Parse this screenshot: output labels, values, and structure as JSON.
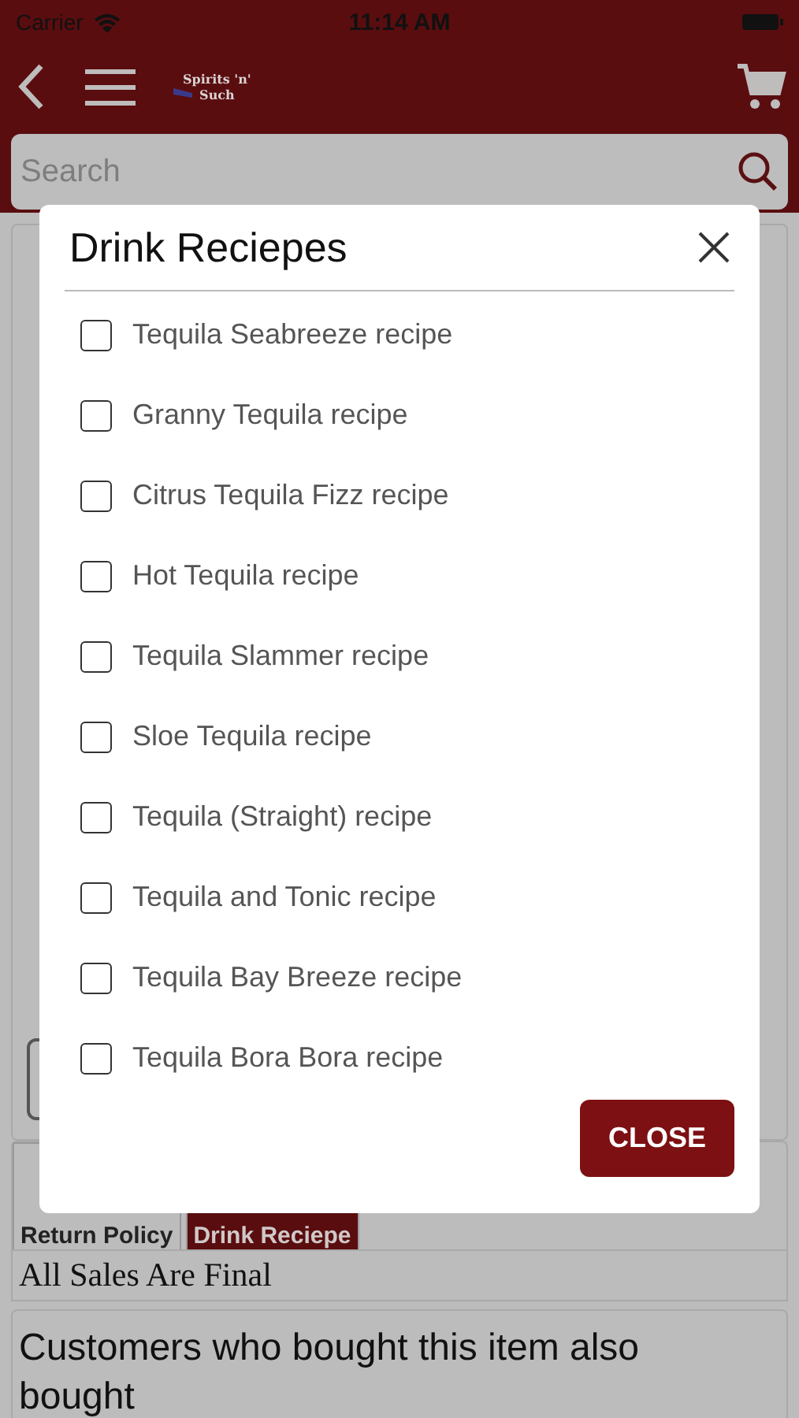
{
  "status_bar": {
    "carrier": "Carrier",
    "time": "11:14 AM"
  },
  "nav": {
    "logo_lines": [
      "Spirits 'n'",
      "Such"
    ]
  },
  "search": {
    "placeholder": "Search"
  },
  "tabs": [
    {
      "label": "Return Policy",
      "selected": false
    },
    {
      "label": "Drink Reciepe",
      "selected": true
    }
  ],
  "tab_content": "All Sales Are Final",
  "related": {
    "title": "Customers who bought this item also bought"
  },
  "dialog": {
    "title": "Drink Reciepes",
    "items": [
      {
        "label": "Tequila Seabreeze recipe",
        "checked": false
      },
      {
        "label": "Granny Tequila recipe",
        "checked": false
      },
      {
        "label": "Citrus Tequila Fizz recipe",
        "checked": false
      },
      {
        "label": "Hot Tequila recipe",
        "checked": false
      },
      {
        "label": "Tequila Slammer recipe",
        "checked": false
      },
      {
        "label": "Sloe Tequila recipe",
        "checked": false
      },
      {
        "label": "Tequila (Straight) recipe",
        "checked": false
      },
      {
        "label": "Tequila and Tonic recipe",
        "checked": false
      },
      {
        "label": "Tequila Bay Breeze recipe",
        "checked": false
      },
      {
        "label": "Tequila Bora Bora recipe",
        "checked": false
      }
    ],
    "button": "CLOSE"
  }
}
